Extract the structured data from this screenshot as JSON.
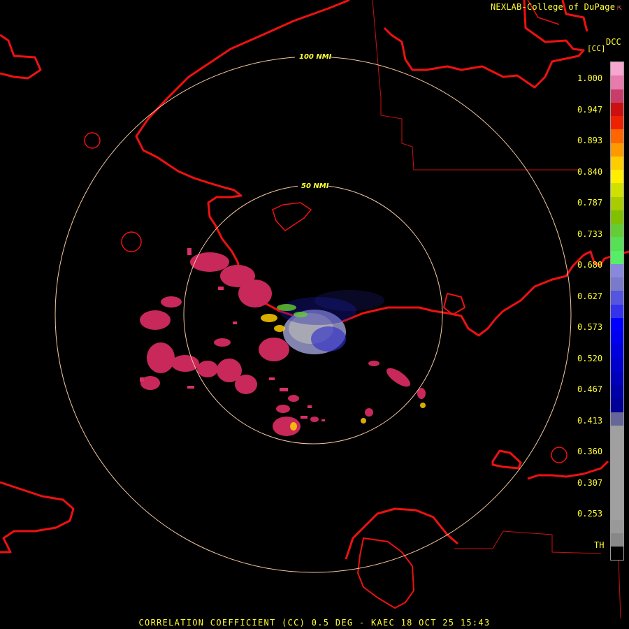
{
  "header": {
    "credit": "NEXLAB-College of DuPage",
    "credit_mark_icon": "nexlab-logo-icon"
  },
  "legend": {
    "product_code": "DCC",
    "unit": "[CC]",
    "ticks": [
      "1.000",
      "0.947",
      "0.893",
      "0.840",
      "0.787",
      "0.733",
      "0.680",
      "0.627",
      "0.573",
      "0.520",
      "0.467",
      "0.413",
      "0.360",
      "0.307",
      "0.253",
      "TH"
    ],
    "colors": [
      "#f7a6d0",
      "#e87aac",
      "#c83c6a",
      "#cc1010",
      "#ee2200",
      "#ff6600",
      "#ff9900",
      "#ffcc00",
      "#ffee00",
      "#d0e000",
      "#a8cc00",
      "#80c000",
      "#66cc33",
      "#55e055",
      "#55ee66",
      "#8888dd",
      "#7a7acc",
      "#5555dd",
      "#3333ee",
      "#0000ff",
      "#0000ee",
      "#0000dd",
      "#0000cc",
      "#0000bb",
      "#0000aa",
      "#000099",
      "#666699",
      "#a0a0a0",
      "#a0a0a0",
      "#a0a0a0",
      "#a0a0a0",
      "#a0a0a0",
      "#a0a0a0",
      "#a0a0a0",
      "#999999",
      "#888888",
      "#000000"
    ]
  },
  "map": {
    "range_rings": [
      {
        "label": "100 NMI"
      },
      {
        "label": "50 NMI"
      }
    ],
    "colors": {
      "coastline": "#ee1111",
      "county_lines": "#cc1111",
      "rings": "#f5c8a0",
      "high_cc": "#c8285a",
      "low_cc": "#9a9aa8",
      "biological": "#1a1ab0"
    }
  },
  "footer": {
    "caption": "CORRELATION COEFFICIENT (CC) 0.5 DEG - KAEC 18 OCT 25 15:43"
  }
}
